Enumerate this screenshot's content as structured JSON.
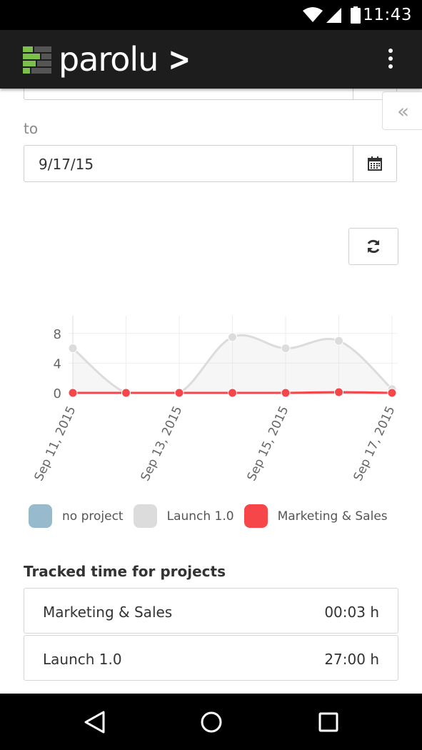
{
  "status_bar": {
    "time": "11:43",
    "icons": [
      "wifi-icon",
      "cell-signal-icon",
      "battery-icon"
    ]
  },
  "app_bar": {
    "brand": "parolu",
    "chevron": ">",
    "menu_icon": "more-vert-icon"
  },
  "filters": {
    "from_value": "",
    "to_label": "to",
    "to_value": "9/17/15",
    "calendar_icon": "calendar-icon",
    "side_tab_glyph": "«",
    "refresh_icon": "refresh-icon"
  },
  "chart_data": {
    "type": "line",
    "x": [
      "Sep 11, 2015",
      "Sep 12, 2015",
      "Sep 13, 2015",
      "Sep 14, 2015",
      "Sep 15, 2015",
      "Sep 16, 2015",
      "Sep 17, 2015"
    ],
    "x_tick_labels": [
      "Sep 11, 2015",
      "Sep 13, 2015",
      "Sep 15, 2015",
      "Sep 17, 2015"
    ],
    "ylim": [
      0,
      10
    ],
    "y_ticks": [
      0,
      4,
      8
    ],
    "grid": true,
    "series": [
      {
        "name": "no project",
        "color": "#97bbcd",
        "values": [
          0,
          0,
          0,
          0,
          0,
          0,
          0
        ]
      },
      {
        "name": "Launch 1.0",
        "color": "#dcdcdc",
        "values": [
          6,
          0,
          0,
          7.5,
          6,
          7,
          0.5
        ],
        "fill": true
      },
      {
        "name": "Marketing & Sales",
        "color": "#f7464a",
        "values": [
          0,
          0,
          0,
          0,
          0,
          0.1,
          0
        ]
      }
    ]
  },
  "projects": {
    "title": "Tracked time for projects",
    "rows": [
      {
        "name": "Marketing & Sales",
        "time": "00:03 h"
      },
      {
        "name": "Launch 1.0",
        "time": "27:00 h"
      }
    ]
  },
  "nav_bar": {
    "icons": [
      "back-icon",
      "home-icon",
      "recents-icon"
    ]
  }
}
